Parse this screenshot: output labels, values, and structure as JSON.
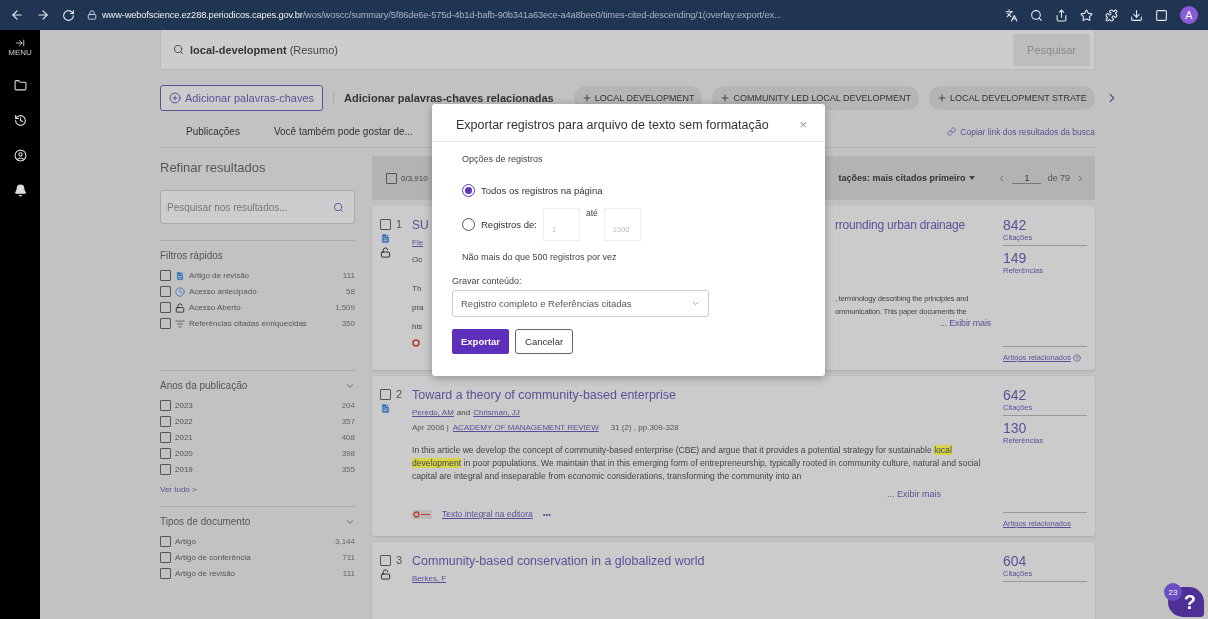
{
  "browser": {
    "url_host": "www-webofscience.ez288.periodicos.capes.gov.br",
    "url_path": "/wos/woscc/summary/5f86de6e-575d-4b1d-bafb-90b341a63ece-a4a8bee0/times-cited-descending/1(overlay:export/ex...",
    "avatar": "A"
  },
  "rail": {
    "menu_label": "MENU"
  },
  "search": {
    "query": "local-development",
    "field": "(Resumo)",
    "button": "Pesquisar"
  },
  "keywords": {
    "add_button": "Adicionar palavras-chaves",
    "related_label": "Adicionar palavras-chaves relacionadas",
    "chips": [
      "LOCAL DEVELOPMENT",
      "COMMUNITY LED LOCAL DEVELOPMENT",
      "LOCAL DEVELOPMENT STRATE"
    ]
  },
  "nav": {
    "links": [
      "Publicações",
      "Você também pode gostar de..."
    ],
    "copy_link": "Copiar link dos resultados da busca"
  },
  "refine": {
    "title": "Refinar resultados",
    "search_placeholder": "Pesquisar nos resultados...",
    "quick_filters": {
      "title": "Filtros rápidos",
      "items": [
        {
          "kind": "review",
          "label": "Artigo de revisão",
          "count": "111",
          "checked": false
        },
        {
          "kind": "early",
          "label": "Acesso antecipado",
          "count": "58",
          "checked": false
        },
        {
          "kind": "open",
          "label": "Acesso Aberto",
          "count": "1,509",
          "checked": false
        },
        {
          "kind": "enriched",
          "label": "Referências citadas enriquecidas",
          "count": "350",
          "checked": false
        }
      ]
    },
    "years": {
      "title": "Anos da publicação",
      "items": [
        {
          "label": "2023",
          "count": "204",
          "checked": false
        },
        {
          "label": "2022",
          "count": "357",
          "checked": false
        },
        {
          "label": "2021",
          "count": "408",
          "checked": false
        },
        {
          "label": "2020",
          "count": "398",
          "checked": false
        },
        {
          "label": "2019",
          "count": "355",
          "checked": false
        }
      ],
      "see_all": "Ver tudo >"
    },
    "doc_types": {
      "title": "Tipos de documento",
      "items": [
        {
          "label": "Artigo",
          "count": "3,144",
          "checked": false
        },
        {
          "label": "Artigo de conferência",
          "count": "711",
          "checked": false
        },
        {
          "label": "Artigo de revisão",
          "count": "111",
          "checked": false
        }
      ]
    }
  },
  "results": {
    "select_count": "0/3,910",
    "select_checked": false,
    "sort": "tações: mais citados primeiro",
    "page": "1",
    "page_total": "de 79",
    "items": [
      {
        "kind": "partial",
        "number": "1",
        "checked": false,
        "badges": [
          {
            "kind": "review"
          },
          {
            "kind": "open"
          }
        ],
        "title_left": "SU",
        "title_right": "rrounding urban drainage",
        "authors_left": "Fle",
        "meta_left": "Oc",
        "abstract_left": [
          "Th",
          "pra",
          "his"
        ],
        "abstract_right": [
          ", terminology describing the principles and",
          "ommunication. This paper documents the"
        ],
        "show_more": "... Exibir mais",
        "citations": "842",
        "citations_label": "Citações",
        "references": "149",
        "references_label": "Referências",
        "related": "Artigos relacionados",
        "related_help": true
      },
      {
        "kind": "full",
        "number": "2",
        "checked": false,
        "badges": [
          {
            "kind": "review"
          }
        ],
        "title": "Toward a theory of community-based enterprise",
        "authors": [
          "Peredo, AM",
          "Chrisman, JJ"
        ],
        "authors_joiner": "and",
        "date": "Apr 2006 |",
        "journal": "ACADEMY OF MANAGEMENT REVIEW",
        "volume": "31 (2) , pp.309-328",
        "abstract": [
          {
            "text": "In this article we develop the concept of community-based enterprise (CBE) and argue that it provides a potential strategy for sustainable ",
            "highlight": false
          },
          {
            "text": "local development",
            "highlight": true
          },
          {
            "text": " in poor populations. We maintain that in this emerging form of entrepreneurship, typically rooted in community culture, natural and social capital are integral and inseparable from economic considerations, transforming the community into an",
            "highlight": false
          }
        ],
        "show_more": "... Exibir mais",
        "full_text": "Texto integral na editora",
        "more": "•••",
        "citations": "642",
        "citations_label": "Citações",
        "references": "130",
        "references_label": "Referências",
        "related": "Artigos relacionados",
        "related_help": false
      },
      {
        "kind": "full",
        "number": "3",
        "checked": false,
        "badges": [
          {
            "kind": "open"
          }
        ],
        "title": "Community-based conservation in a globalized world",
        "authors": [
          "Berkes, F"
        ],
        "citations": "604",
        "citations_label": "Citações"
      }
    ]
  },
  "modal": {
    "title": "Exportar registros para arquivo de texto sem formatação",
    "close": "×",
    "section": "Opções de registros",
    "options": [
      {
        "label": "Todos os registros na página",
        "selected": true
      },
      {
        "label": "Registros de:",
        "selected": false
      }
    ],
    "range": {
      "from_placeholder": "1",
      "to_label": "até",
      "to_placeholder": "1000"
    },
    "note": "Não mais do que 500 registros por vez",
    "content_label": "Gravar conteúdo:",
    "content_value": "Registro completo e Referências citadas",
    "primary": "Exportar",
    "secondary": "Cancelar"
  },
  "help": {
    "badge": "23",
    "label": "?"
  }
}
